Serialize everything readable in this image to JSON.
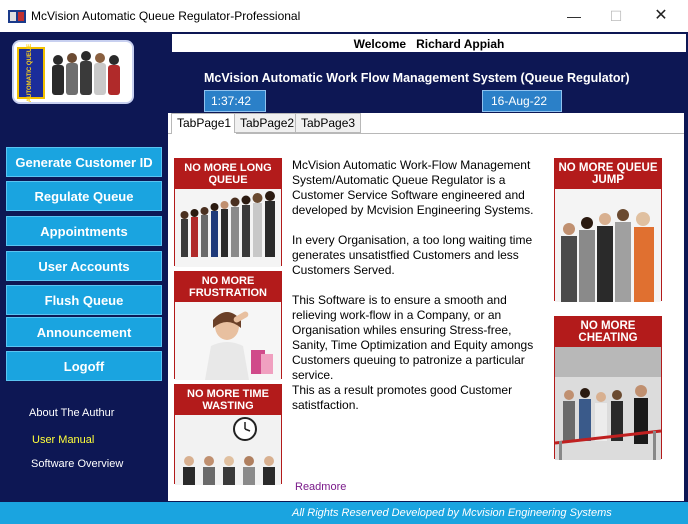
{
  "window": {
    "title": "McVision Automatic Queue Regulator-Professional",
    "minimize": "—",
    "maximize": "☐",
    "close": "✕"
  },
  "header": {
    "welcome_label": "Welcome",
    "user_name": "Richard Appiah",
    "system_title": "McVision Automatic Work Flow Management System (Queue Regulator)",
    "time": "1:37:42",
    "date": "16-Aug-22"
  },
  "sidebar": {
    "buttons": [
      {
        "label": "Generate Customer ID"
      },
      {
        "label": "Regulate Queue"
      },
      {
        "label": "Appointments"
      },
      {
        "label": "User Accounts"
      },
      {
        "label": "Flush Queue"
      },
      {
        "label": "Announcement"
      },
      {
        "label": "Logoff"
      }
    ],
    "links": [
      {
        "label": "About The Authur"
      },
      {
        "label": "User Manual"
      },
      {
        "label": "Software Overview"
      }
    ]
  },
  "tabs": [
    {
      "label": "TabPage1"
    },
    {
      "label": "TabPage2"
    },
    {
      "label": "TabPage3"
    }
  ],
  "banners": {
    "left": [
      {
        "heading": "NO MORE LONG QUEUE"
      },
      {
        "heading": "NO MORE FRUSTRATION"
      },
      {
        "heading": "NO MORE TIME WASTING"
      }
    ],
    "right": [
      {
        "heading": "NO MORE QUEUE JUMP"
      },
      {
        "heading": "NO MORE CHEATING"
      }
    ]
  },
  "content": {
    "p1": "McVision Automatic Work-Flow Management System/Automatic Queue Regulator is a Customer Service Software engineered and developed by Mcvision Engineering Systems.",
    "p2": "In every Organisation, a too long waiting time generates unsatistfied Customers and less Customers Served.",
    "p3": "This Software is to ensure a smooth and relieving work-flow in a Company, or an Organisation whiles ensuring Stress-free, Sanity, Time Optimization and Equity amongs Customers queuing to patronize a particular service.",
    "p4": "This as a result promotes good Customer satistfaction.",
    "readmore": "Readmore"
  },
  "footer": {
    "text": "All Rights Reserved Developed by Mcvision Engineering Systems"
  },
  "colors": {
    "frame": "#0d1754",
    "nav_button": "#1aa4e0",
    "banner_red": "#b31b1b",
    "link_yellow": "#ffff3a"
  }
}
